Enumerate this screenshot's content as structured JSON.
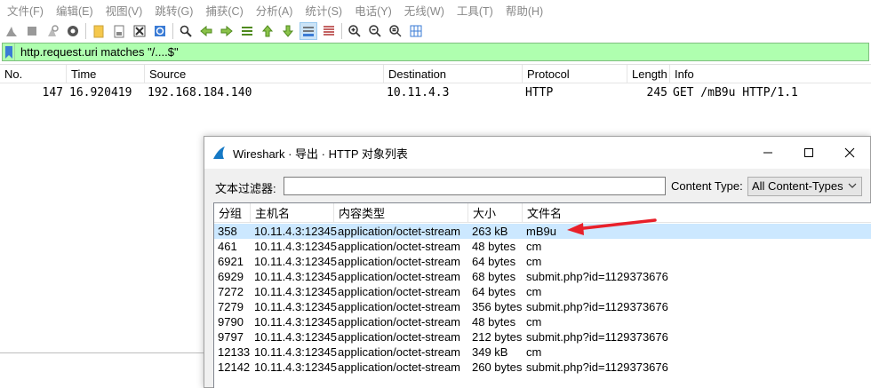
{
  "menu": [
    "文件(F)",
    "编辑(E)",
    "视图(V)",
    "跳转(G)",
    "捕获(C)",
    "分析(A)",
    "统计(S)",
    "电话(Y)",
    "无线(W)",
    "工具(T)",
    "帮助(H)"
  ],
  "toolbar": {
    "icons": [
      "shark-fin-start-icon",
      "stop-capture-icon",
      "restart-capture-icon",
      "capture-options-icon",
      "open-file-icon",
      "save-file-icon",
      "close-file-icon",
      "reload-file-icon",
      "find-packet-icon",
      "go-back-icon",
      "go-forward-icon",
      "go-to-packet-icon",
      "go-first-icon",
      "go-last-icon",
      "autoscroll-icon",
      "colorize-icon",
      "zoom-in-icon",
      "zoom-out-icon",
      "zoom-normal-icon",
      "resize-columns-icon"
    ]
  },
  "display_filter": {
    "value": "http.request.uri matches \"/....$\"",
    "bg_color": "#afffaf"
  },
  "packet_list": {
    "headers": [
      "No.",
      "Time",
      "Source",
      "Destination",
      "Protocol",
      "Length",
      "Info"
    ],
    "rows": [
      {
        "no": "147",
        "time": "16.920419",
        "source": "192.168.184.140",
        "destination": "10.11.4.3",
        "protocol": "HTTP",
        "length": "245",
        "info": "GET /mB9u HTTP/1.1"
      }
    ]
  },
  "dialog": {
    "title": "Wireshark · 导出 · HTTP 对象列表",
    "text_filter_label": "文本过滤器:",
    "text_filter_value": "",
    "content_type_label": "Content Type:",
    "content_type_value": "All Content-Types",
    "headers": [
      "分组",
      "主机名",
      "内容类型",
      "大小",
      "文件名"
    ],
    "rows": [
      {
        "packet": "358",
        "host": "10.11.4.3:12345",
        "content_type": "application/octet-stream",
        "size": "263 kB",
        "filename": "mB9u",
        "selected": true
      },
      {
        "packet": "461",
        "host": "10.11.4.3:12345",
        "content_type": "application/octet-stream",
        "size": "48 bytes",
        "filename": "cm"
      },
      {
        "packet": "6921",
        "host": "10.11.4.3:12345",
        "content_type": "application/octet-stream",
        "size": "64 bytes",
        "filename": "cm"
      },
      {
        "packet": "6929",
        "host": "10.11.4.3:12345",
        "content_type": "application/octet-stream",
        "size": "68 bytes",
        "filename": "submit.php?id=1129373676"
      },
      {
        "packet": "7272",
        "host": "10.11.4.3:12345",
        "content_type": "application/octet-stream",
        "size": "64 bytes",
        "filename": "cm"
      },
      {
        "packet": "7279",
        "host": "10.11.4.3:12345",
        "content_type": "application/octet-stream",
        "size": "356 bytes",
        "filename": "submit.php?id=1129373676"
      },
      {
        "packet": "9790",
        "host": "10.11.4.3:12345",
        "content_type": "application/octet-stream",
        "size": "48 bytes",
        "filename": "cm"
      },
      {
        "packet": "9797",
        "host": "10.11.4.3:12345",
        "content_type": "application/octet-stream",
        "size": "212 bytes",
        "filename": "submit.php?id=1129373676"
      },
      {
        "packet": "12133",
        "host": "10.11.4.3:12345",
        "content_type": "application/octet-stream",
        "size": "349 kB",
        "filename": "cm"
      },
      {
        "packet": "12142",
        "host": "10.11.4.3:12345",
        "content_type": "application/octet-stream",
        "size": "260 bytes",
        "filename": "submit.php?id=1129373676"
      }
    ]
  },
  "colors": {
    "selected_row": "#cce8ff",
    "annotation_arrow": "#e8202a",
    "filter_bg": "#afffaf"
  }
}
